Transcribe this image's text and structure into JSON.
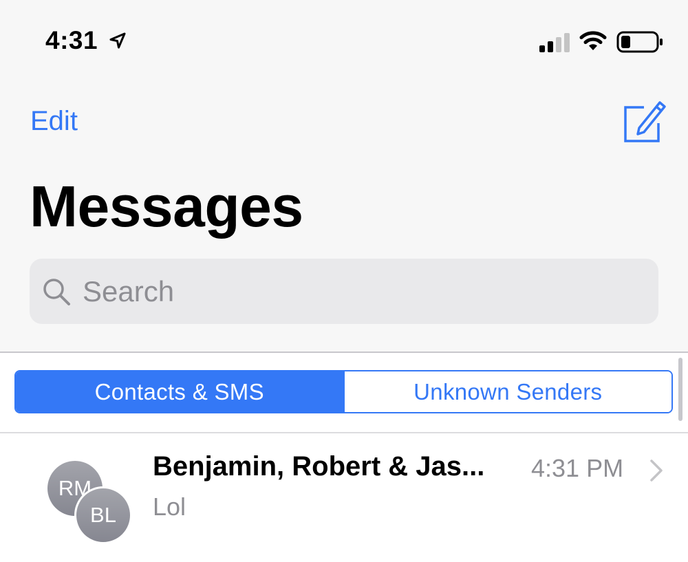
{
  "status_bar": {
    "time": "4:31",
    "location_icon": "location-arrow-icon",
    "signal_icon": "cellular-signal-icon",
    "wifi_icon": "wifi-icon",
    "battery_icon": "battery-icon"
  },
  "nav": {
    "edit_label": "Edit",
    "compose_icon": "compose-icon"
  },
  "title": "Messages",
  "search": {
    "placeholder": "Search",
    "icon": "search-icon"
  },
  "segments": [
    {
      "label": "Contacts & SMS",
      "active": true
    },
    {
      "label": "Unknown Senders",
      "active": false
    }
  ],
  "conversations": [
    {
      "name": "Benjamin, Robert & Jas...",
      "time": "4:31 PM",
      "preview": "Lol",
      "avatars": [
        "RM",
        "BL"
      ]
    }
  ],
  "colors": {
    "accent": "#3478f6",
    "secondary_text": "#8e8e93",
    "header_bg": "#f7f7f7",
    "search_bg": "#e9e9eb"
  }
}
